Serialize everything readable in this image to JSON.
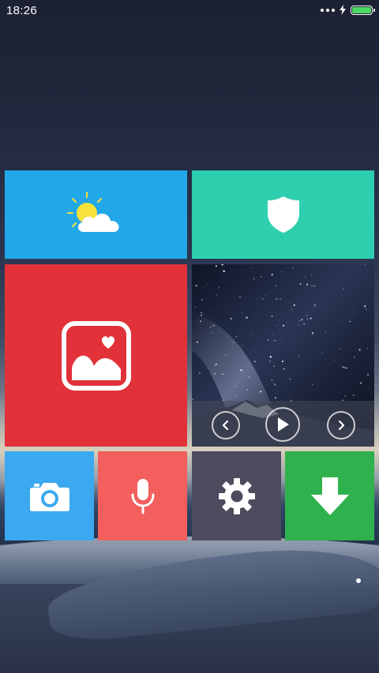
{
  "status_bar": {
    "time": "18:26",
    "battery_level": 1.0,
    "battery_color": "#4cd964"
  },
  "tiles": [
    {
      "id": "weather",
      "icon": "weather-icon",
      "color": "#22a7e8"
    },
    {
      "id": "security",
      "icon": "shield-icon",
      "color": "#2ecfaf"
    },
    {
      "id": "gallery",
      "icon": "gallery-icon",
      "color": "#e03238"
    },
    {
      "id": "music",
      "icon": "music-player",
      "controls": [
        "previous-icon",
        "play-icon",
        "next-icon"
      ]
    },
    {
      "id": "camera",
      "icon": "camera-icon",
      "color": "#3aa9ef"
    },
    {
      "id": "recorder",
      "icon": "microphone-icon",
      "color": "#f25f5c"
    },
    {
      "id": "settings",
      "icon": "gear-icon",
      "color": "#4d4b5e"
    },
    {
      "id": "download",
      "icon": "download-arrow-icon",
      "color": "#2fb14d"
    }
  ]
}
